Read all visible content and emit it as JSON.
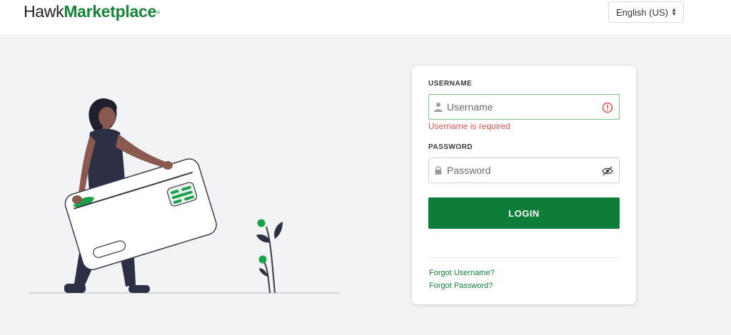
{
  "header": {
    "logo_part1": "Hawk",
    "logo_part2": "Marketplace",
    "logo_mark": "®",
    "language": "English (US)"
  },
  "login": {
    "username_label": "USERNAME",
    "username_placeholder": "Username",
    "username_error": "Username is required",
    "password_label": "PASSWORD",
    "password_placeholder": "Password",
    "login_button": "LOGIN",
    "forgot_username": "Forgot Username?",
    "forgot_password": "Forgot Password?"
  },
  "colors": {
    "brand_green": "#0f7d3a",
    "error_red": "#e0524f",
    "background": "#f2f3f5"
  },
  "icons": [
    "user-icon",
    "error-icon",
    "lock-icon",
    "eye-off-icon",
    "sort-caret-icon"
  ]
}
